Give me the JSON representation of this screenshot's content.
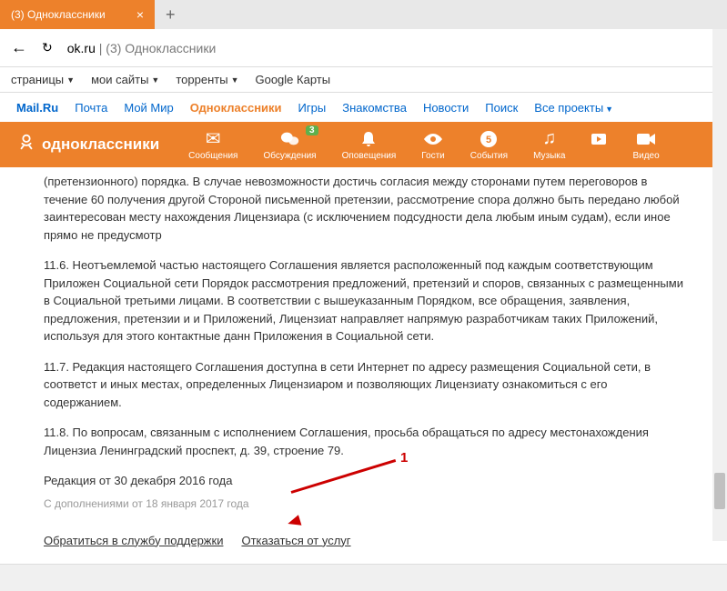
{
  "browser": {
    "tab_title": "(3) Одноклассники",
    "url_domain": "ok.ru",
    "url_path": "(3) Одноклассники"
  },
  "bookmarks": {
    "pages": "страницы",
    "my_sites": "мои сайты",
    "torrents": "торренты",
    "google_maps": "Google Карты"
  },
  "top_nav": {
    "mail": "Mail.Ru",
    "pochta": "Почта",
    "moi_mir": "Мой Мир",
    "odnoklassniki": "Одноклассники",
    "igry": "Игры",
    "znakomstva": "Знакомства",
    "novosti": "Новости",
    "poisk": "Поиск",
    "vse_proekty": "Все проекты"
  },
  "site_nav": {
    "logo": "одноклассники",
    "messages": "Сообщения",
    "obsuzhdeniya": "Обсуждения",
    "badge_count": "3",
    "opovescheniya": "Оповещения",
    "gosti": "Гости",
    "sobytiya": "События",
    "muzyka": "Музыка",
    "video": "Видео"
  },
  "content": {
    "p1": "(претензионного) порядка. В случае невозможности достичь согласия между сторонами путем переговоров в течение 60 получения другой Стороной письменной претензии, рассмотрение спора должно быть передано любой заинтересован месту нахождения Лицензиара (с исключением подсудности дела любым иным судам), если иное прямо не предусмотр",
    "p2": "11.6. Неотъемлемой частью настоящего Соглашения является расположенный под каждым соответствующим Приложен Социальной сети Порядок рассмотрения предложений, претензий и споров, связанных с размещенными в Социальной третьими лицами. В соответствии с вышеуказанным Порядком, все обращения, заявления, предложения, претензии и и Приложений, Лицензиат направляет напрямую разработчикам таких Приложений, используя для этого контактные данн Приложения в Социальной сети.",
    "p3": "11.7. Редакция настоящего Соглашения доступна в сети Интернет по адресу размещения Социальной сети, в соответст и иных местах, определенных Лицензиаром и позволяющих Лицензиату ознакомиться с его содержанием.",
    "p4": "11.8. По вопросам, связанным с исполнением Соглашения, просьба обращаться по адресу местонахождения Лицензиа Ленинградский проспект, д. 39, строение 79.",
    "revision": "Редакция от 30 декабря 2016 года",
    "addendum": "С дополнениями от 18 января 2017 года"
  },
  "actions": {
    "support": "Обратиться в службу поддержки",
    "refuse": "Отказаться от услуг"
  },
  "annotation": {
    "label": "1"
  }
}
